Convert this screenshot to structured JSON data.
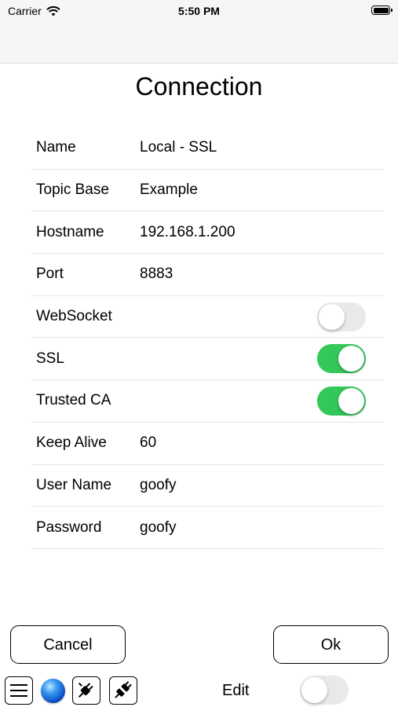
{
  "status_bar": {
    "carrier": "Carrier",
    "time": "5:50 PM"
  },
  "page": {
    "title": "Connection"
  },
  "fields": [
    {
      "label": "Name",
      "value": "Local - SSL"
    },
    {
      "label": "Topic Base",
      "value": "Example"
    },
    {
      "label": "Hostname",
      "value": "192.168.1.200"
    },
    {
      "label": "Port",
      "value": "8883"
    },
    {
      "label": "WebSocket",
      "toggle": false
    },
    {
      "label": "SSL",
      "toggle": true
    },
    {
      "label": "Trusted CA",
      "toggle": true
    },
    {
      "label": "Keep Alive",
      "value": "60"
    },
    {
      "label": "User Name",
      "value": "goofy"
    },
    {
      "label": "Password",
      "value": "goofy"
    }
  ],
  "buttons": {
    "cancel": "Cancel",
    "ok": "Ok"
  },
  "toolbar": {
    "icons": [
      "menu-icon",
      "globe-icon",
      "plug-icon",
      "plug-icon"
    ],
    "edit_label": "Edit",
    "edit_toggle": false
  },
  "colors": {
    "toggle_on": "#34c759",
    "toggle_off": "#e9e9eb"
  }
}
